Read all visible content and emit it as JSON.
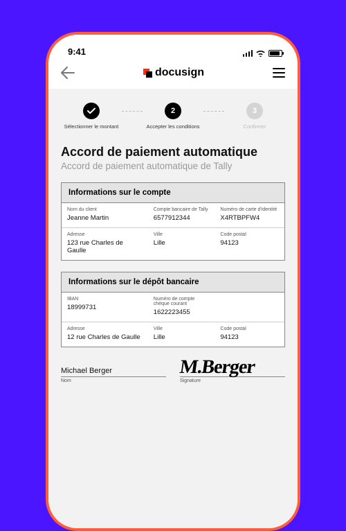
{
  "status": {
    "time": "9:41"
  },
  "brand": {
    "name": "docusign"
  },
  "stepper": {
    "steps": [
      {
        "num": "✓",
        "label": "Sélectionner le montant",
        "state": "done"
      },
      {
        "num": "2",
        "label": "Accepter les conditions",
        "state": "active"
      },
      {
        "num": "3",
        "label": "Confirmer",
        "state": "pending"
      }
    ]
  },
  "page": {
    "title": "Accord de paiement automatique",
    "subtitle": "Accord de paiement automatique de Tally"
  },
  "account": {
    "heading": "Informations sur le compte",
    "r1": {
      "c1l": "Nom du client",
      "c1v": "Jeanne Martin",
      "c2l": "Compte bancaire de Tally",
      "c2v": "6577912344",
      "c3l": "Numéro de carte d'identité",
      "c3v": "X4RTBPFW4"
    },
    "r2": {
      "c1l": "Adresse",
      "c1v": "123 rue Charles de Gaulle",
      "c2l": "Ville",
      "c2v": "Lille",
      "c3l": "Code postal",
      "c3v": "94123"
    }
  },
  "deposit": {
    "heading": "Informations sur le dépôt bancaire",
    "r1": {
      "c1l": "IBAN",
      "c1v": "18999731",
      "c2l": "Numéro de compte chèque courant",
      "c2v": "1622223455",
      "c3l": "",
      "c3v": ""
    },
    "r2": {
      "c1l": "Adresse",
      "c1v": "12 rue Charles de Gaulle",
      "c2l": "Ville",
      "c2v": "Lille",
      "c3l": "Code postal",
      "c3v": "94123"
    }
  },
  "signature": {
    "name": "Michael Berger",
    "name_lbl": "Nom",
    "sig_lbl": "Signature",
    "scribble": "M.Berger"
  }
}
